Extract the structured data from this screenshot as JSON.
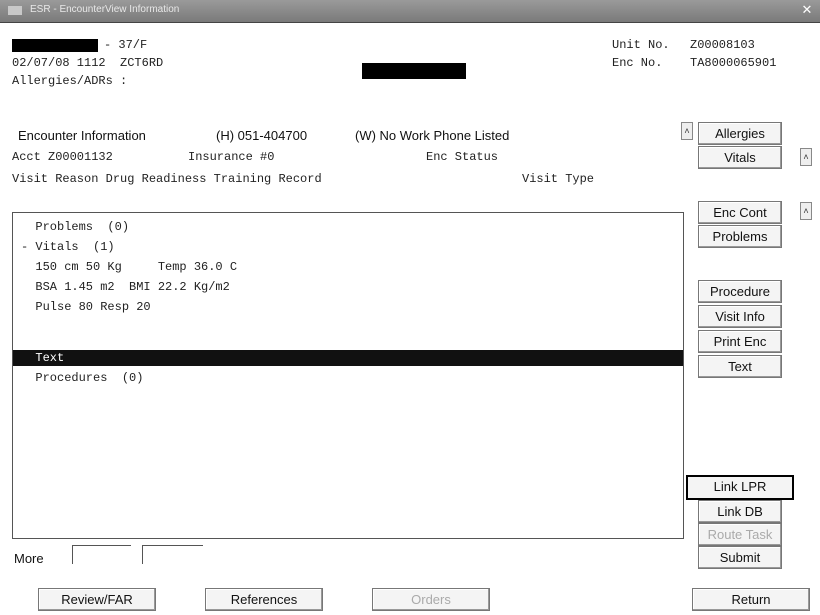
{
  "window": {
    "title": "ESR - EncounterView Information",
    "close_glyph": "✕"
  },
  "header": {
    "patient_suffix": "- 37/F",
    "date_line": "02/07/08 1112  ZCT6RD",
    "allergies_line": "Allergies/ADRs :",
    "unit_label": "Unit No.",
    "unit_value": "Z00008103",
    "enc_label": "Enc No.",
    "enc_value": "TA8000065901"
  },
  "encounter": {
    "heading": "Encounter Information",
    "home_phone": "(H) 051-404700",
    "work_phone": "(W) No Work Phone Listed",
    "acct": "Acct Z00001132",
    "insurance": "Insurance #0",
    "enc_status": "Enc Status",
    "visit_reason": "Visit Reason Drug Readiness Training Record",
    "visit_type": "Visit Type"
  },
  "tree": [
    {
      "text": "  Problems  (0)",
      "selected": false
    },
    {
      "text": "- Vitals  (1)",
      "selected": false
    },
    {
      "text": "  150 cm 50 Kg     Temp 36.0 C",
      "selected": false
    },
    {
      "text": "  BSA 1.45 m2  BMI 22.2 Kg/m2",
      "selected": false
    },
    {
      "text": "  Pulse 80 Resp 20",
      "selected": false
    },
    {
      "text": "",
      "selected": false
    },
    {
      "text": "  Text",
      "selected": true
    },
    {
      "text": "  Procedures  (0)",
      "selected": false
    }
  ],
  "right_buttons": {
    "allergies": "Allergies",
    "vitals": "Vitals",
    "enc_cont": "Enc Cont",
    "problems": "Problems",
    "procedure": "Procedure",
    "visit_info": "Visit Info",
    "print_enc": "Print Enc",
    "text": "Text",
    "link_lpr": "Link LPR",
    "link_db": "Link DB",
    "route_task": "Route Task",
    "submit": "Submit",
    "return": "Return"
  },
  "bottom": {
    "more_label": "More",
    "more_field1": "",
    "more_field2": "",
    "review_far": "Review/FAR",
    "references": "References",
    "orders": "Orders"
  }
}
